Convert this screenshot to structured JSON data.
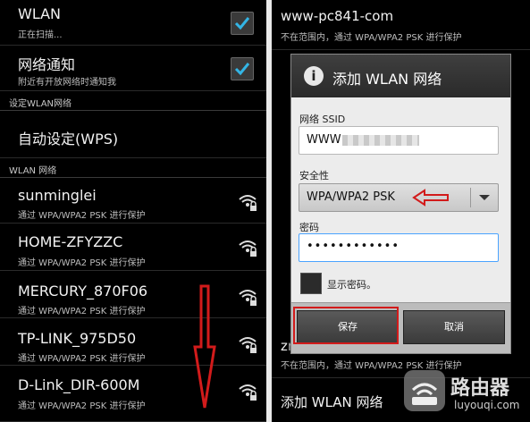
{
  "left": {
    "wlan": {
      "title": "WLAN",
      "status": "正在扫描..."
    },
    "notify": {
      "title": "网络通知",
      "desc": "附近有开放网络时通知我"
    },
    "section_setup": "设定WLAN网络",
    "wps": "自动设定(WPS)",
    "section_networks": "WLAN 网络",
    "networks": [
      {
        "ssid": "sunminglei",
        "security": "通过 WPA/WPA2 PSK 进行保护"
      },
      {
        "ssid": "HOME-ZFYZZC",
        "security": "通过 WPA/WPA2 PSK 进行保护"
      },
      {
        "ssid": "MERCURY_870F06",
        "security": "通过 WPA/WPA2 PSK 进行保护"
      },
      {
        "ssid": "TP-LINK_975D50",
        "security": "通过 WPA/WPA2 PSK 进行保护"
      },
      {
        "ssid": "D-Link_DIR-600M",
        "security": "通过 WPA/WPA2 PSK 进行保护"
      }
    ]
  },
  "right": {
    "top_ssid": "www-pc841-com",
    "top_status": "不在范围内，通过 WPA/WPA2 PSK 进行保护",
    "bottom_ssid": "zr",
    "bottom_status": "不在范围内，通过 WPA/WPA2 PSK 进行保护",
    "add_network": "添加 WLAN 网络"
  },
  "dialog": {
    "title": "添加 WLAN 网络",
    "ssid_label": "网络 SSID",
    "ssid_value": "WWW",
    "security_label": "安全性",
    "security_value": "WPA/WPA2 PSK",
    "password_label": "密码",
    "password_value": "••••••••••••",
    "show_password": "显示密码。",
    "save": "保存",
    "cancel": "取消"
  },
  "logo": {
    "title": "路由器",
    "site": "luyouqi.com"
  },
  "colors": {
    "highlight": "#d21b1b",
    "check": "#33b5e5"
  }
}
